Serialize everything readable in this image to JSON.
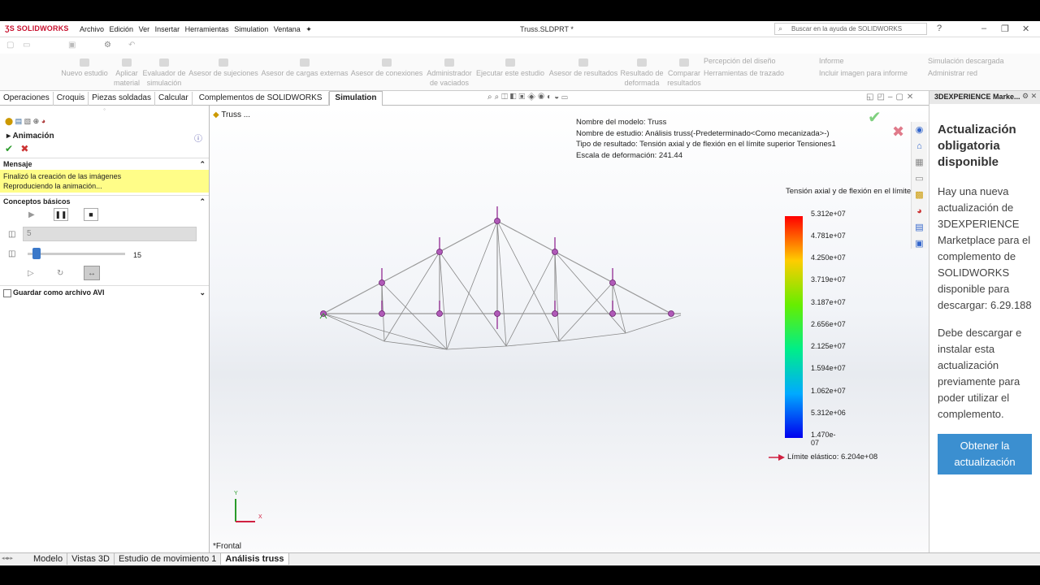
{
  "app": {
    "logo": "SOLIDWORKS",
    "title": "Truss.SLDPRT *",
    "menu": [
      "Archivo",
      "Edición",
      "Ver",
      "Insertar",
      "Herramientas",
      "Simulation",
      "Ventana"
    ],
    "search_placeholder": "Buscar en la ayuda de SOLIDWORKS"
  },
  "ribbon": {
    "items": [
      "Nuevo estudio",
      "Aplicar material",
      "Evaluador de simulación",
      "Asesor de sujeciones",
      "Asesor de cargas externas",
      "Asesor de conexiones",
      "Administrador de vaciados",
      "Ejecutar este estudio",
      "Asesor de resultados",
      "Resultado de deformada",
      "Comparar resultados"
    ],
    "right_items": [
      "Percepción del diseño",
      "Herramientas de trazado",
      "Informe",
      "Incluir imagen para informe",
      "Simulación descargada",
      "Administrar red"
    ]
  },
  "tabs": [
    "Operaciones",
    "Croquis",
    "Piezas soldadas",
    "Calcular",
    "Complementos de SOLIDWORKS",
    "Simulation"
  ],
  "active_tab": "Simulation",
  "left_panel": {
    "title": "Animación",
    "message_header": "Mensaje",
    "message_lines": [
      "Finalizó la creación de las imágenes",
      "Reproduciendo la animación..."
    ],
    "basics_header": "Conceptos básicos",
    "frames_value": "5",
    "speed_value": "15",
    "save_avi": "Guardar como archivo AVI"
  },
  "viewport": {
    "tree_label": "Truss  ...",
    "info": [
      "Nombre del modelo: Truss",
      "Nombre de estudio: Análisis truss(-Predeterminado<Como mecanizada>-)",
      "Tipo de resultado: Tensión axial y de flexión en el límite superior Tensiones1",
      "Escala de deformación: 241.44"
    ],
    "legend_title": "Tensión axial y de flexión en el límite",
    "legend_values": [
      "5.312e+07",
      "4.781e+07",
      "4.250e+07",
      "3.719e+07",
      "3.187e+07",
      "2.656e+07",
      "2.125e+07",
      "1.594e+07",
      "1.062e+07",
      "5.312e+06",
      "1.470e-07"
    ],
    "yield_label": "Límite elástico: 6.204e+08",
    "view_label": "*Frontal",
    "axis_x": "X",
    "axis_y": "Y"
  },
  "task_pane": {
    "header": "3DEXPERIENCE Marke...",
    "title": "Actualización obligatoria disponible",
    "body1": "Hay una nueva actualización de 3DEXPERIENCE Marketplace para el complemento de SOLIDWORKS disponible para descargar: 6.29.188",
    "body2": "Debe descargar e instalar esta actualización previamente para poder utilizar el complemento.",
    "button": "Obtener la actualización"
  },
  "bottom_tabs": [
    "Modelo",
    "Vistas 3D",
    "Estudio de movimiento 1",
    "Análisis truss"
  ],
  "active_bottom_tab": "Análisis truss",
  "colors": {
    "accent_red": "#c8102e",
    "button_blue": "#3b8fd0",
    "message_yellow": "#fffd88"
  }
}
